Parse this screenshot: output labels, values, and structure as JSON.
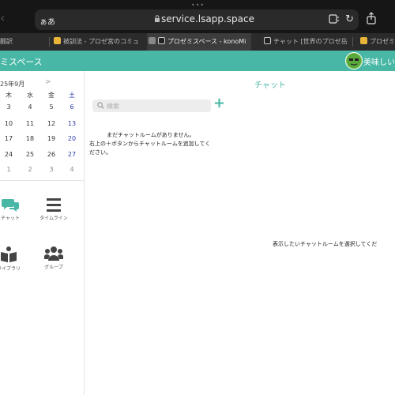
{
  "browser": {
    "text_size_label": "ぁあ",
    "url": "service.lsapp.space",
    "tabs": [
      {
        "label": "翻訳",
        "active": false
      },
      {
        "label": "被訓法 - プロゼ宮のコミュ",
        "active": false
      },
      {
        "label": "プロゼミスペース - konoMi",
        "active": true
      },
      {
        "label": "チャット [世界のプロゼ岳",
        "active": false
      },
      {
        "label": "プロゼミ",
        "active": false
      }
    ]
  },
  "app": {
    "title": "ミスペース",
    "user_name": "美味しい",
    "accent_color": "#49b7a6"
  },
  "calendar": {
    "month_label": "25年9月",
    "next_label": ">",
    "weekdays": [
      "木",
      "水",
      "金",
      "土"
    ],
    "weeks": [
      [
        "3",
        "4",
        "5",
        "6"
      ],
      [
        "10",
        "11",
        "12",
        "13"
      ],
      [
        "17",
        "18",
        "19",
        "20"
      ],
      [
        "24",
        "25",
        "26",
        "27"
      ],
      [
        "1",
        "2",
        "3",
        "4"
      ]
    ]
  },
  "menu": {
    "chat_label": "チャット",
    "timeline_label": "タイムライン",
    "library_label": "ライブラリ",
    "group_label": "グループ",
    "icons": [
      "chat-icon",
      "timeline-icon",
      "library-icon",
      "group-icon"
    ]
  },
  "main": {
    "title": "チャット",
    "search_placeholder": "検索",
    "empty_line1": "まだチャットルームがありません。",
    "empty_line2": "右上の＋ボタンからチャットルームを追加してください。",
    "select_message": "表示したいチャットルームを選択してくだ"
  }
}
